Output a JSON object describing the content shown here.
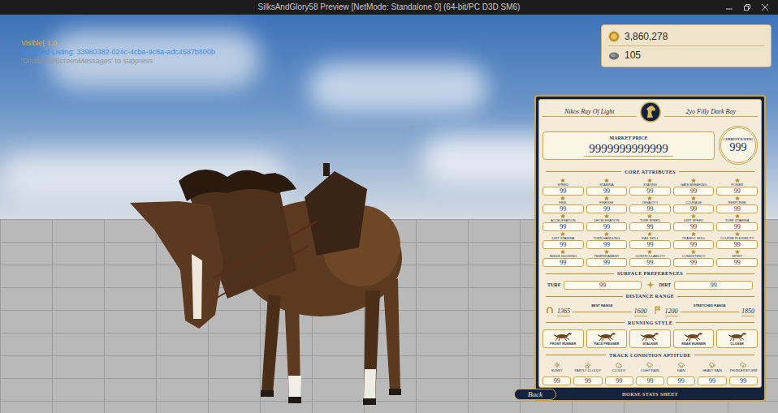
{
  "window": {
    "title": "SilksAndGlory58 Preview [NetMode: Standalone 0]  (64-bit/PC D3D SM6)"
  },
  "debug_messages": [
    {
      "text": "Visible| 1.0",
      "color": "#e8a92c"
    },
    {
      "text": "Selected Listing: 33980382-024c-4cba-9c8a-adc4587b800b",
      "color": "#3d8fe8"
    },
    {
      "text": "'DisableAllScreenMessages' to suppress",
      "color": "#8f969c"
    }
  ],
  "currency": [
    {
      "kind": "coin",
      "amount": "3,860,278"
    },
    {
      "kind": "gem",
      "amount": "105"
    }
  ],
  "stats_sheet": {
    "horse": {
      "name": "Nikos Ray Of Light",
      "info": "2yo Filly Dark Bay"
    },
    "market_price": {
      "label": "MARKET PRICE",
      "value": "9999999999999"
    },
    "rating": {
      "label": "CURRENT RATING",
      "value": "999"
    },
    "core_attributes": {
      "title": "CORE ATTRIBUTES",
      "items": [
        {
          "label": "SPEED",
          "value": "99"
        },
        {
          "label": "STAMINA",
          "value": "99"
        },
        {
          "label": "STAYING",
          "value": "99"
        },
        {
          "label": "GATE BREAKING",
          "value": "99"
        },
        {
          "label": "POWER",
          "value": "99"
        },
        {
          "label": "FEEL",
          "value": "99"
        },
        {
          "label": "FINESSE",
          "value": "99"
        },
        {
          "label": "TENACITY",
          "value": "99"
        },
        {
          "label": "COURAGE",
          "value": "99"
        },
        {
          "label": "RESPONSE",
          "value": "99"
        },
        {
          "label": "ACCELERATION",
          "value": "99"
        },
        {
          "label": "DECELERATION",
          "value": "99"
        },
        {
          "label": "TURF SPEED",
          "value": "99"
        },
        {
          "label": "DIRT SPEED",
          "value": "99"
        },
        {
          "label": "TURF STAMINA",
          "value": "99"
        },
        {
          "label": "DIRT STAMINA",
          "value": "99"
        },
        {
          "label": "TURN HANDLING",
          "value": "99"
        },
        {
          "label": "RAIL SKILL",
          "value": "99"
        },
        {
          "label": "TRAFFIC SKILL",
          "value": "99"
        },
        {
          "label": "COURSE FLEXIBILITY",
          "value": "99"
        },
        {
          "label": "INSIDE HOOKING",
          "value": "99"
        },
        {
          "label": "TEMPERAMENT",
          "value": "99"
        },
        {
          "label": "CONTROLLABILITY",
          "value": "99"
        },
        {
          "label": "CONSISTENCY",
          "value": "99"
        },
        {
          "label": "SPIRIT",
          "value": "99"
        }
      ]
    },
    "surface": {
      "title": "SURFACE PREFERENCES",
      "items": [
        {
          "label": "TURF",
          "value": "99"
        },
        {
          "label": "DIRT",
          "value": "99"
        }
      ]
    },
    "distance": {
      "title": "DISTANCE RANGE",
      "ranges": [
        {
          "label": "BEST RANGE",
          "from": "1365",
          "to": "1600"
        },
        {
          "label": "STRETCHED RANGE",
          "from": "1200",
          "to": "1850"
        }
      ]
    },
    "running_style": {
      "title": "RUNNING STYLE",
      "styles": [
        {
          "label": "FRONT RUNNER",
          "selected": false
        },
        {
          "label": "PACE PRESSER",
          "selected": false
        },
        {
          "label": "STALKER",
          "selected": false
        },
        {
          "label": "REAR RUNNER",
          "selected": false
        },
        {
          "label": "CLOSER",
          "selected": false
        }
      ]
    },
    "track_condition": {
      "title": "TRACK CONDITION APTITUDE",
      "items": [
        {
          "label": "SUNNY",
          "value": "99"
        },
        {
          "label": "PARTLY CLOUDY",
          "value": "99"
        },
        {
          "label": "CLOUDY",
          "value": "99"
        },
        {
          "label": "LIGHT RAIN",
          "value": "99"
        },
        {
          "label": "RAIN",
          "value": "99"
        },
        {
          "label": "HEAVY RAIN",
          "value": "99"
        },
        {
          "label": "THUNDERSTORM",
          "value": "99"
        }
      ]
    },
    "back_button": "Back",
    "footer": "HORSE STATS SHEET"
  }
}
